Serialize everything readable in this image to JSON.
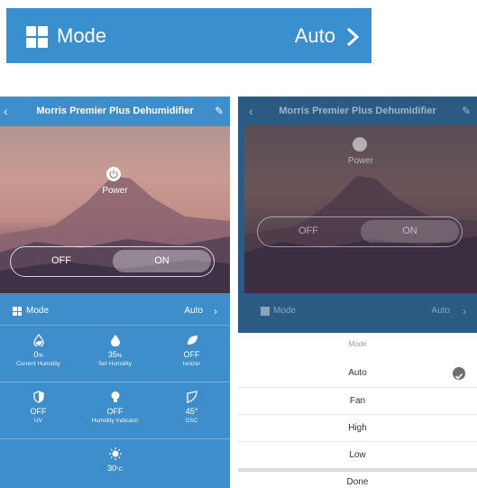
{
  "banner": {
    "label": "Mode",
    "value": "Auto",
    "icon": "grid-icon",
    "chevron": "chevron-right-icon"
  },
  "left_phone": {
    "title": "Morris Premier Plus Dehumidifier",
    "power_label": "Power",
    "toggle": {
      "off": "OFF",
      "on": "ON"
    },
    "mode": {
      "label": "Mode",
      "value": "Auto"
    },
    "row1": [
      {
        "value": "0",
        "unit": "%",
        "label": "Current Humidity",
        "icon": "water-drop-outline-icon"
      },
      {
        "value": "35",
        "unit": "%",
        "label": "Set Humidity",
        "icon": "water-drop-icon"
      },
      {
        "value": "OFF",
        "unit": "",
        "label": "Ionizer",
        "icon": "leaf-icon"
      }
    ],
    "row2": [
      {
        "value": "OFF",
        "unit": "",
        "label": "UV",
        "icon": "shield-icon"
      },
      {
        "value": "OFF",
        "unit": "",
        "label": "Humidity Indicator",
        "icon": "bulb-icon"
      },
      {
        "value": "45°",
        "unit": "",
        "label": "OSC",
        "icon": "fan-angle-icon"
      }
    ],
    "row3": {
      "value": "30",
      "unit": "°C",
      "icon": "sun-icon"
    }
  },
  "right_phone": {
    "title": "Morris Premier Plus Dehumidifier",
    "power_label": "Power",
    "toggle": {
      "off": "OFF",
      "on": "ON"
    },
    "mode": {
      "label": "Mode",
      "value": "Auto"
    },
    "sheet": {
      "title": "Mode",
      "options": [
        "Auto",
        "Fan",
        "High",
        "Low"
      ],
      "selected": "Auto",
      "done": "Done"
    }
  },
  "colors": {
    "primary": "#3d8ecb",
    "banner": "#3a8fcf",
    "dim": "#2b5a82"
  }
}
